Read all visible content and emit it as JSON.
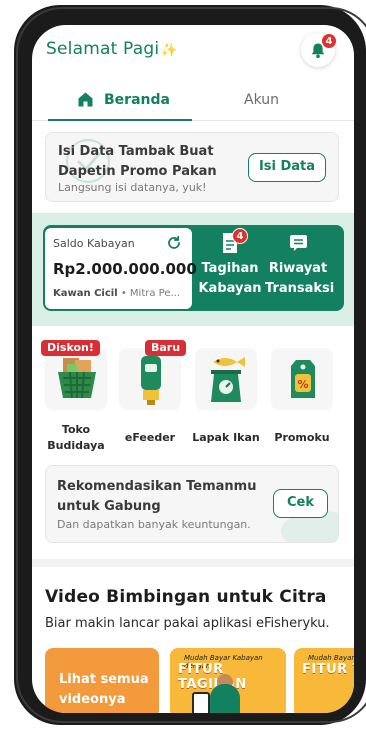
{
  "header": {
    "greeting": "Selamat Pagi",
    "notification_count": "4"
  },
  "tabs": [
    {
      "label": "Beranda",
      "active": true
    },
    {
      "label": "Akun",
      "active": false
    }
  ],
  "promo_card": {
    "title": "Isi Data Tambak Buat Dapetin Promo Pakan",
    "subtitle": "Langsung isi datanya, yuk!",
    "button_label": "Isi Data"
  },
  "balance": {
    "label": "Saldo Kabayan",
    "amount": "Rp2.000.000.000",
    "footer_bold": "Kawan Cicil",
    "footer_rest": "Mitra Pe..."
  },
  "quick_actions": [
    {
      "label": "Tagihan Kabayan",
      "badge": "4"
    },
    {
      "label": "Riwayat Transaksi"
    }
  ],
  "features": [
    {
      "label": "Toko Budidaya",
      "badge": "Diskon!"
    },
    {
      "label": "eFeeder",
      "badge": "Baru"
    },
    {
      "label": "Lapak Ikan"
    },
    {
      "label": "Promoku"
    }
  ],
  "referral": {
    "title": "Rekomendasikan Temanmu untuk Gabung",
    "subtitle": "Dan dapatkan banyak keuntungan.",
    "button_label": "Cek"
  },
  "video_section": {
    "title": "Video Bimbingan untuk Citra",
    "subtitle": "Biar makin lancar pakai aplikasi eFisheryku.",
    "see_all_label": "Lihat semua videonya",
    "thumbnails": [
      {
        "tag": "Mudah Bayar Kabayan dengan",
        "headline": "FITUR TAGIHAN"
      },
      {
        "tag": "Mudah Bayar",
        "headline": "FITUR T"
      }
    ]
  },
  "colors": {
    "brand_green": "#13805f",
    "band_green": "#d9efe6",
    "badge_red": "#e0312f",
    "orange": "#f29a3c"
  }
}
